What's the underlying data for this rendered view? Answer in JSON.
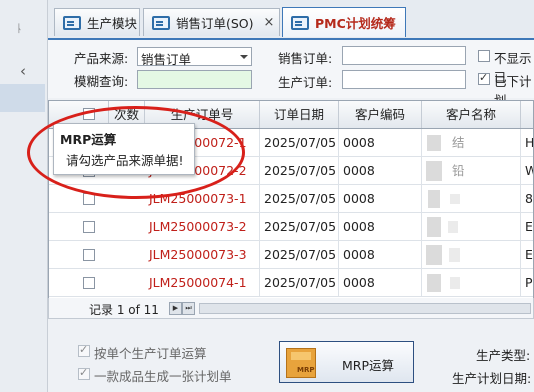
{
  "left_rail": {
    "pin_glyph": "ᚿ",
    "collapse_glyph": "‹"
  },
  "tabs": [
    {
      "label": "生产模块",
      "closable": false,
      "active": false
    },
    {
      "label": "销售订单(SO)",
      "closable": true,
      "active": false
    },
    {
      "label": "PMC计划统筹",
      "closable": false,
      "active": true
    }
  ],
  "tab_close_glyph": "×",
  "form": {
    "source_label": "产品来源:",
    "source_value": "销售订单",
    "fuzzy_label": "模糊查询:",
    "fuzzy_value": "",
    "sales_order_label": "销售订单:",
    "sales_order_value": "",
    "production_order_label": "生产订单:",
    "production_order_value": "",
    "hide_label": "不显示已",
    "hide_checked": false,
    "issued_label": "已下计划",
    "issued_checked": true
  },
  "grid": {
    "columns": [
      "",
      "次数",
      "生产订单号",
      "订单日期",
      "客户编码",
      "客户名称",
      ""
    ],
    "rows": [
      {
        "order_no": "JLM25000072-1",
        "date": "2025/07/05",
        "customer_code": "0008",
        "customer_name_tail": "结",
        "extra": "H"
      },
      {
        "order_no": "JLM25000072-2",
        "date": "2025/07/05",
        "customer_code": "0008",
        "customer_name_tail": "铅",
        "extra": "W"
      },
      {
        "order_no": "JLM25000073-1",
        "date": "2025/07/05",
        "customer_code": "0008",
        "customer_name_tail": "",
        "extra": "8"
      },
      {
        "order_no": "JLM25000073-2",
        "date": "2025/07/05",
        "customer_code": "0008",
        "customer_name_tail": "",
        "extra": "E"
      },
      {
        "order_no": "JLM25000073-3",
        "date": "2025/07/05",
        "customer_code": "0008",
        "customer_name_tail": "",
        "extra": "E"
      },
      {
        "order_no": "JLM25000074-1",
        "date": "2025/07/05",
        "customer_code": "0008",
        "customer_name_tail": "",
        "extra": "P"
      }
    ]
  },
  "tooltip": {
    "title": "MRP运算",
    "message": "请勾选产品来源单据!"
  },
  "pager": {
    "text": "记录 1 of 11",
    "next_glyph": "▶",
    "last_glyph": "⏭"
  },
  "options": {
    "single_order_label": "按单个生产订单运算",
    "single_order_checked": true,
    "one_plan_label": "一款成品生成一张计划单",
    "one_plan_checked": true
  },
  "mrp_button": {
    "label": "MRP运算",
    "icon_text": "MRP"
  },
  "right_fields": {
    "production_type_label": "生产类型:",
    "plan_date_label": "生产计划日期:"
  }
}
